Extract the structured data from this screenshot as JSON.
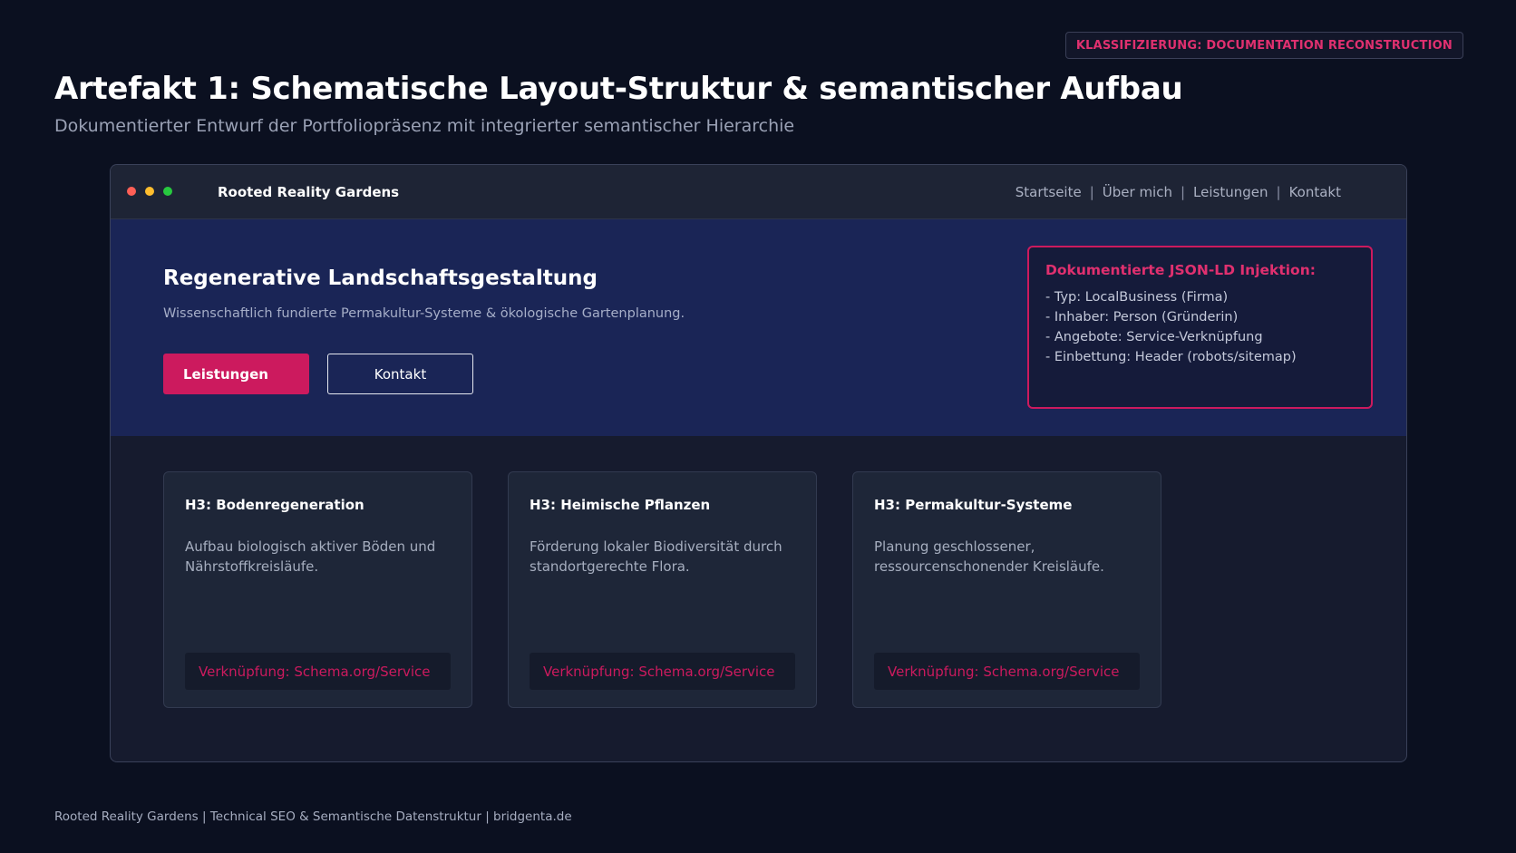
{
  "badge": "KLASSIFIZIERUNG: DOCUMENTATION RECONSTRUCTION",
  "page": {
    "title": "Artefakt 1: Schematische Layout-Struktur & semantischer Aufbau",
    "subtitle": "Dokumentierter Entwurf der Portfoliopräsenz mit integrierter semantischer Hierarchie"
  },
  "window": {
    "dots": [
      {
        "name": "close",
        "color": "#ff5f56"
      },
      {
        "name": "minimize",
        "color": "#ffbd2e"
      },
      {
        "name": "maximize",
        "color": "#27c93f"
      }
    ],
    "brand": "Rooted Reality Gardens",
    "nav": {
      "items": [
        "Startseite",
        "Über mich",
        "Leistungen",
        "Kontakt"
      ],
      "separator": "|"
    }
  },
  "hero": {
    "title": "Regenerative Landschaftsgestaltung",
    "text": "Wissenschaftlich fundierte Permakultur-Systeme & ökologische Gartenplanung.",
    "primary_button": "Leistungen",
    "secondary_button": "Kontakt"
  },
  "jsonld": {
    "title": "Dokumentierte JSON-LD Injektion:",
    "items": [
      "- Typ: LocalBusiness (Firma)",
      "- Inhaber: Person (Gründerin)",
      "- Angebote: Service-Verknüpfung",
      "- Einbettung: Header (robots/sitemap)"
    ]
  },
  "cards": [
    {
      "title": "H3: Bodenregeneration",
      "text": "Aufbau biologisch aktiver Böden und Nährstoffkreisläufe.",
      "link": "Verknüpfung: Schema.org/Service"
    },
    {
      "title": "H3: Heimische Pflanzen",
      "text": "Förderung lokaler Biodiversität durch standortgerechte Flora.",
      "link": "Verknüpfung: Schema.org/Service"
    },
    {
      "title": "H3: Permakultur-Systeme",
      "text": "Planung geschlossener, ressourcenschonender Kreisläufe.",
      "link": "Verknüpfung: Schema.org/Service"
    }
  ],
  "footer": "Rooted Reality Gardens | Technical SEO & Semantische Datenstruktur | bridgenta.de"
}
